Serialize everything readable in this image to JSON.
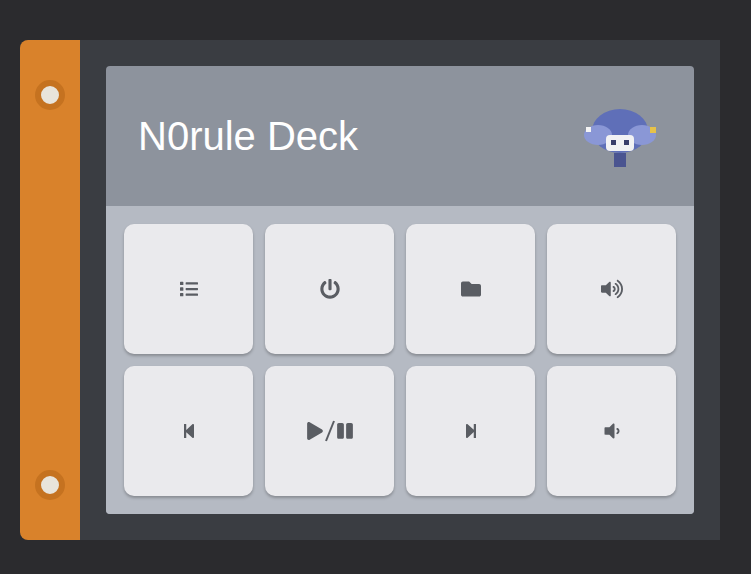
{
  "header": {
    "title": "N0rule Deck"
  },
  "buttons": [
    {
      "kind": "list"
    },
    {
      "kind": "power"
    },
    {
      "kind": "folder"
    },
    {
      "kind": "louder"
    },
    {
      "kind": "previous"
    },
    {
      "kind": "playpause"
    },
    {
      "kind": "next"
    },
    {
      "kind": "quieter"
    }
  ]
}
